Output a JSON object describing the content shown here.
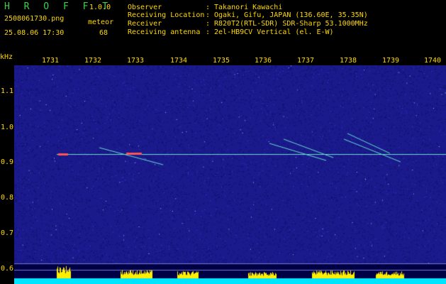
{
  "header": {
    "logo": "H R O F F T",
    "version": "1.0.0",
    "filename": "2508061730.png",
    "datetime": "25.08.06 17:30",
    "meteor_label": "meteor",
    "meteor_count": "68",
    "info": [
      {
        "label": "Observer",
        "value": "Takanori Kawachi"
      },
      {
        "label": "Receiving Location",
        "value": "Ogaki, Gifu, JAPAN (136.60E, 35.35N)"
      },
      {
        "label": "Receiver",
        "value": "R820T2(RTL-SDR) SDR-Sharp 53.1000MHz"
      },
      {
        "label": "Receiving antenna",
        "value": "2el-HB9CV Vertical (el. E-W)"
      }
    ]
  },
  "axes": {
    "unit_label": "kHz",
    "x_ticks": [
      "1731",
      "1732",
      "1733",
      "1734",
      "1735",
      "1736",
      "1737",
      "1738",
      "1739",
      "1740"
    ],
    "y_ticks": [
      "1.1",
      "1.0",
      "0.9",
      "0.8",
      "0.7",
      "0.6"
    ]
  },
  "colors": {
    "text": "#ffd900",
    "logo": "#3bd24a",
    "background": "#000000",
    "noise_bg": "#1a1a8c",
    "carrier": "#66ddcc",
    "baseline": "#00e5ff",
    "peaks": "#ffee00"
  }
}
